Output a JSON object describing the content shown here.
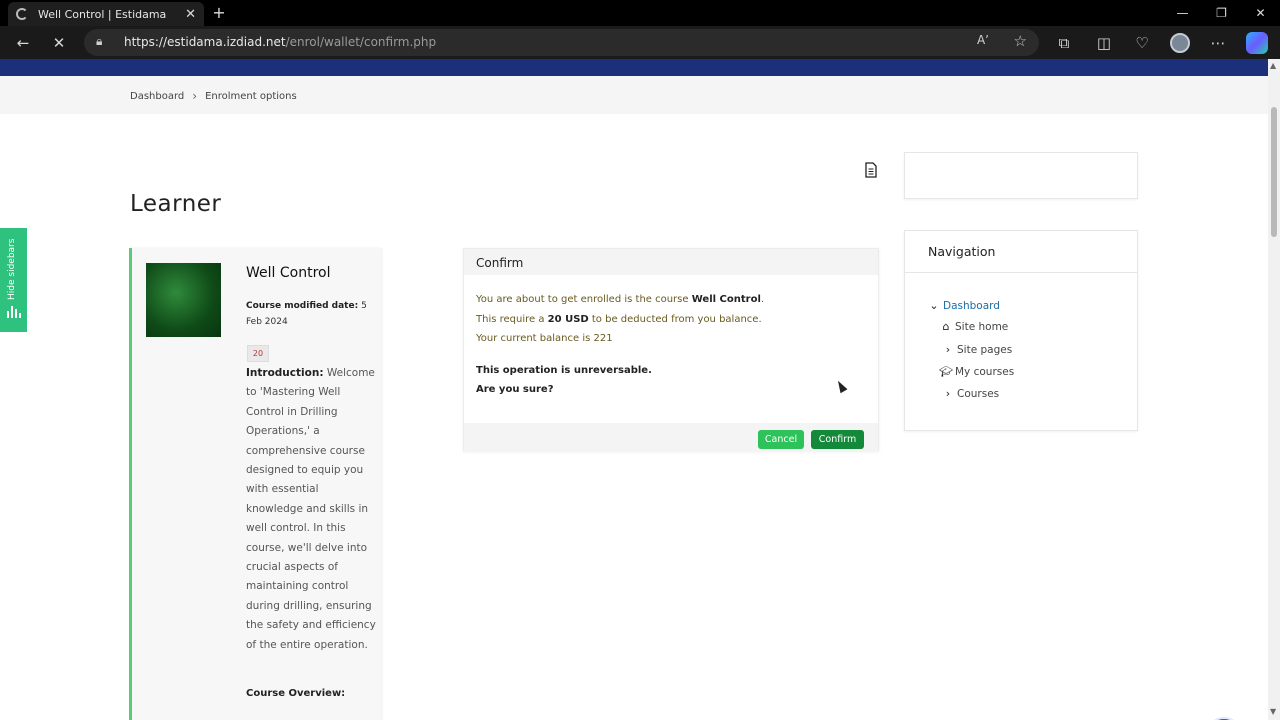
{
  "browser": {
    "tab_title": "Well Control | Estidama",
    "new_tab_symbol": "+",
    "url_host": "https://estidama.izdiad.net",
    "url_path": "/enrol/wallet/confirm.php",
    "read_aloud": "Aʼ"
  },
  "breadcrumb": {
    "items": [
      "Dashboard",
      "Enrolment options"
    ]
  },
  "sidebar_toggle": {
    "label": "Hide sidebars"
  },
  "page": {
    "heading": "Learner"
  },
  "course": {
    "title": "Well Control",
    "modified_label": "Course modified date:",
    "modified_value": "5 Feb 2024",
    "calendar_badge": "20",
    "intro_label": "Introduction:",
    "intro_text": "Welcome to 'Mastering Well Control in Drilling Operations,' a comprehensive course designed to equip you with essential knowledge and skills in well control. In this course, we'll delve into crucial aspects of maintaining control during drilling, ensuring the safety and efficiency of the entire operation.",
    "overview_label": "Course Overview:"
  },
  "confirm": {
    "title": "Confirm",
    "line1_prefix": "You are about to get enrolled is the course",
    "line1_course": "Well Control",
    "line1_suffix": ".",
    "line2_prefix": "This require a",
    "line2_amount": "20 USD",
    "line2_suffix": "to be deducted from you balance.",
    "line3": "Your current balance is 221",
    "warning1": "This operation is unreversable.",
    "warning2": "Are you sure?",
    "cancel_label": "Cancel",
    "confirm_label": "Confirm"
  },
  "navigation": {
    "title": "Navigation",
    "dashboard": "Dashboard",
    "site_home": "Site home",
    "site_pages": "Site pages",
    "my_courses": "My courses",
    "courses": "Courses"
  },
  "colors": {
    "accent_green": "#2ec27e",
    "confirm_green": "#138a3a",
    "nav_blue": "#1c2f7a"
  }
}
